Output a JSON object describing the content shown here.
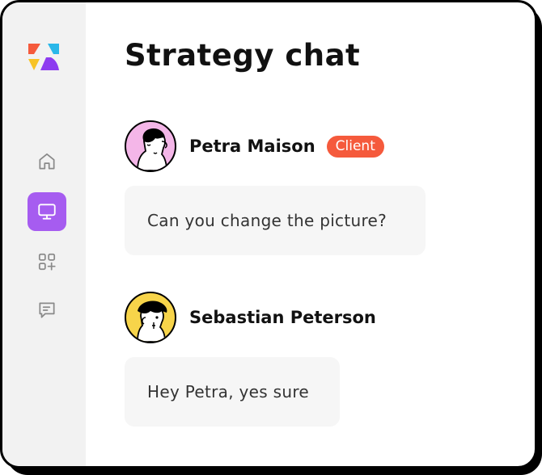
{
  "page": {
    "title": "Strategy chat"
  },
  "sidebar": {
    "logo_icon": "brand-logo-icon",
    "active_color": "#a65cf0",
    "items": [
      {
        "icon": "home-icon",
        "active": false
      },
      {
        "icon": "monitor-icon",
        "active": true
      },
      {
        "icon": "apps-add-icon",
        "active": false
      },
      {
        "icon": "chat-icon",
        "active": false
      }
    ]
  },
  "messages": [
    {
      "author": "Petra Maison",
      "badge": "Client",
      "badge_color": "#f55a3c",
      "avatar_icon": "avatar-petra",
      "avatar_color": "#f4b6e8",
      "text": "Can you change the picture?"
    },
    {
      "author": "Sebastian Peterson",
      "badge": null,
      "avatar_icon": "avatar-sebastian",
      "avatar_color": "#f7d44a",
      "text": "Hey Petra, yes sure"
    }
  ]
}
